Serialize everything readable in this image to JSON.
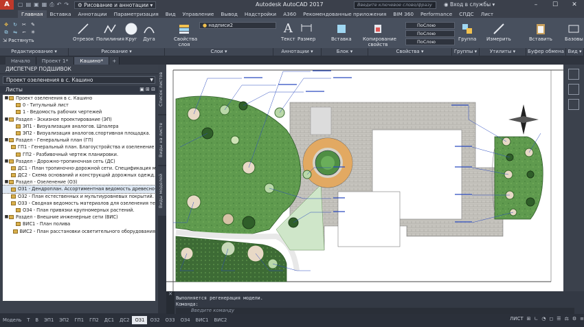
{
  "titlebar": {
    "workspace": "Рисование и аннотации",
    "window_title": "Autodesk AutoCAD 2017",
    "search_placeholder": "Введите ключевое слово/фразу",
    "sign_in": "Вход в службы"
  },
  "ribbon_tabs": [
    "Главная",
    "Вставка",
    "Аннотации",
    "Параметризация",
    "Вид",
    "Управление",
    "Вывод",
    "Надстройки",
    "A360",
    "Рекомендованные приложения",
    "BIM 360",
    "Performance",
    "СПДС",
    "Лист"
  ],
  "ribbon_tools": {
    "line": "Отрезок",
    "polyline": "Полилиния",
    "circle": "Круг",
    "arc": "Дуга",
    "layer_props": "Свойства слоя",
    "layer_name": "надписи2",
    "text": "Текст",
    "dimension": "Размер",
    "insert": "Вставка",
    "match_props": "Копирование свойств",
    "bylayer_1": "ПоСлою",
    "bylayer_2": "ПоСлою",
    "bylayer_3": "ПоСлою",
    "group": "Группа",
    "measure": "Измерить",
    "paste": "Вставить",
    "base": "Базовы",
    "stretch": "Растянуть"
  },
  "ribbon_panels": [
    "Редактирование ▾",
    "Рисование ▾",
    "Слои ▾",
    "Аннотации ▾",
    "Блок ▾",
    "Свойства ▾",
    "Группы ▾",
    "Утилиты ▾",
    "Буфер обмена",
    "Вид ▾"
  ],
  "doc_tabs": [
    "Начало",
    "Проект 1*",
    "Кашино*"
  ],
  "sheet_set": {
    "header": "ДИСПЕТЧЕР ПОДШИВОК",
    "project": "Проект озеленения в с. Кашино",
    "sub_header": "Листы",
    "rows": [
      {
        "text": "Проект озеленения в с. Кашино",
        "level": 0,
        "toggle": "▬"
      },
      {
        "text": "0 - Титульный лист",
        "level": 1
      },
      {
        "text": "1 - Ведомость рабочих чертежей",
        "level": 1
      },
      {
        "text": "Раздел - Эскизное проектирование (ЭП)",
        "level": 0,
        "toggle": "▬"
      },
      {
        "text": "ЭП1 - Визуализация аналогов. Шпалера",
        "level": 1
      },
      {
        "text": "ЭП2 - Визуализация аналогов.спортивная площадка.",
        "level": 1
      },
      {
        "text": "Раздел - Генеральный план (ГП)",
        "level": 0,
        "toggle": "▬"
      },
      {
        "text": "ГП1 - Генеральный план. Благоустройства и озеленение терр",
        "level": 1
      },
      {
        "text": "ГП2 - Разбивочный чертеж планировки.",
        "level": 1
      },
      {
        "text": "Раздел - Дорожно-тропиночная сеть (ДС)",
        "level": 0,
        "toggle": "▬"
      },
      {
        "text": "ДС1 - План тропиночно-дорожной сети. Спецификация матер",
        "level": 1
      },
      {
        "text": "ДС2 - Схема оснований и конструкций дорожных одежд. Специ",
        "level": 1
      },
      {
        "text": "Раздел - Озеленение (ОЗ)",
        "level": 0,
        "toggle": "▬"
      },
      {
        "text": "ОЗ1 - Дендроплан. Ассортиментная ведомость древесно-куст",
        "level": 1,
        "selected": true
      },
      {
        "text": "ОЗ2 - План естественных и мультиуровневых покрытий. Экспли",
        "level": 1
      },
      {
        "text": "ОЗ3 - Сводная ведомость материалов для озеленения террит",
        "level": 1
      },
      {
        "text": "ОЗ4 - План привязки крупномерных растений.",
        "level": 1
      },
      {
        "text": "Раздел - Внешние инженерные сети (ВИС)",
        "level": 0,
        "toggle": "▬"
      },
      {
        "text": "ВИС1 - План полива",
        "level": 1
      },
      {
        "text": "ВИС2 - План расстановки осветительного оборудования",
        "level": 1
      }
    ]
  },
  "side_tabs": [
    "Список листов",
    "Виды на листе",
    "Виды моделей"
  ],
  "command": {
    "line1": "Выполняется регенерация модели.",
    "line2": "Команда:",
    "placeholder": "Введите команду"
  },
  "layout_tabs": [
    "Модель",
    "Т",
    "В",
    "ЭП1",
    "ЭП2",
    "ГП1",
    "ГП2",
    "ДС1",
    "ДС2",
    "ОЗ1",
    "ОЗ2",
    "ОЗ3",
    "ОЗ4",
    "ВИС1",
    "ВИС2"
  ],
  "active_layout": "ОЗ1",
  "status": {
    "space": "ЛИСТ"
  }
}
